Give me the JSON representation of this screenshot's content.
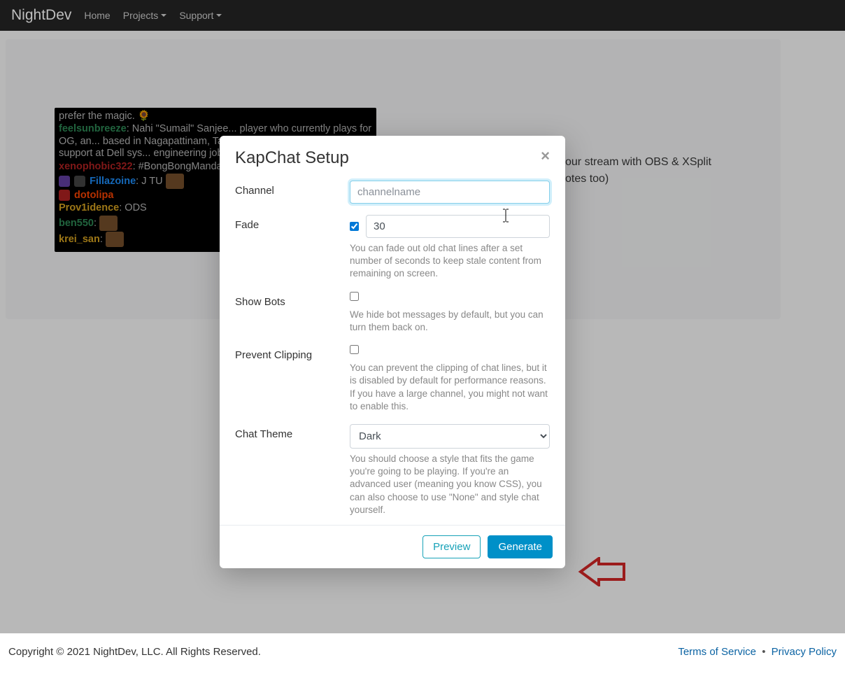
{
  "nav": {
    "brand": "NightDev",
    "home": "Home",
    "projects": "Projects",
    "support": "Support"
  },
  "background": {
    "line1": "our stream with OBS & XSplit",
    "line2": "otes too)"
  },
  "chat": {
    "m0_text": "prefer the magic.",
    "m1_user": "feelsunbreeze",
    "m1_text": ": Nahi \"Sumail\" Sanjee... player who currently plays for OG, an... based in Nagapattinam, Tamilnadu, I... technical systems support at Dell sys... engineering job in a hardware compa...",
    "m2_user": "xenophobic322",
    "m2_text": ": #BongBongMandara...",
    "m3_user": "Fillazoine",
    "m3_text": ": J TU ",
    "m4_user": "dotolipa",
    "m5_user": "Prov1idence",
    "m5_text": ": ODS",
    "m6_user": "ben550",
    "m6_text": ": ",
    "m7_user": "krei_san",
    "m7_text": ": "
  },
  "modal": {
    "title": "KapChat Setup",
    "channel_label": "Channel",
    "channel_placeholder": "channelname",
    "fade_label": "Fade",
    "fade_value": "30",
    "fade_help": "You can fade out old chat lines after a set number of seconds to keep stale content from remaining on screen.",
    "bots_label": "Show Bots",
    "bots_help": "We hide bot messages by default, but you can turn them back on.",
    "clip_label": "Prevent Clipping",
    "clip_help": "You can prevent the clipping of chat lines, but it is disabled by default for performance reasons. If you have a large channel, you might not want to enable this.",
    "theme_label": "Chat Theme",
    "theme_value": "Dark",
    "theme_help": "You should choose a style that fits the game you're going to be playing. If you're an advanced user (meaning you know CSS), you can also choose to use \"None\" and style chat yourself.",
    "preview": "Preview",
    "generate": "Generate"
  },
  "footer": {
    "copyright": "Copyright © 2021 NightDev, LLC. All Rights Reserved.",
    "tos": "Terms of Service",
    "privacy": "Privacy Policy"
  }
}
